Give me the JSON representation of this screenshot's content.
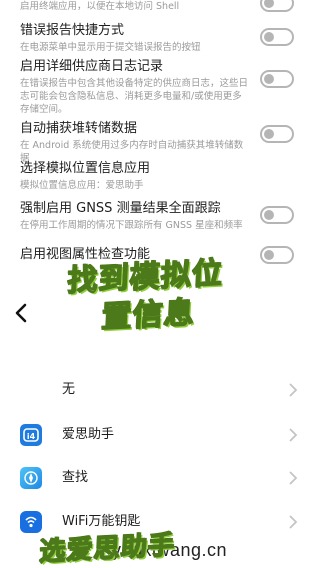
{
  "settings": {
    "items": [
      {
        "title": "",
        "desc": "启用终端应用，以便在本地访问 Shell"
      },
      {
        "title": "错误报告快捷方式",
        "desc": "在电源菜单中显示用于提交错误报告的按钮"
      },
      {
        "title": "启用详细供应商日志记录",
        "desc": "在错误报告中包含其他设备特定的供应商日志，这些日志可能会包含隐私信息、消耗更多电量和/或使用更多存储空间。"
      },
      {
        "title": "自动捕获堆转储数据",
        "desc": "在 Android 系统使用过多内存时自动捕获其堆转储数据"
      },
      {
        "title": "选择模拟位置信息应用",
        "desc": "模拟位置信息应用：爱思助手"
      },
      {
        "title": "强制启用 GNSS 测量结果全面跟踪",
        "desc": "在停用工作周期的情况下跟踪所有 GNSS 星座和频率"
      },
      {
        "title": "启用视图属性检查功能",
        "desc": ""
      }
    ]
  },
  "sheet": {
    "apps": [
      {
        "label": "无",
        "icon": "none"
      },
      {
        "label": "爱思助手",
        "icon": "i4-icon"
      },
      {
        "label": "查找",
        "icon": "find-icon"
      },
      {
        "label": "WiFi万能钥匙",
        "icon": "wifi-key-icon"
      }
    ]
  },
  "overlay": {
    "line1": "找到模拟位",
    "line2": "置信息",
    "line3": "选爱思助手"
  },
  "watermark": "youxiwang.cn",
  "colors": {
    "accent_green": "#8fcf3a",
    "i4_blue": "#1e7be0",
    "find_blue": "#2b9cf0",
    "wifi_blue": "#1a6fe0",
    "toggle_gray": "#b5b5b5"
  }
}
